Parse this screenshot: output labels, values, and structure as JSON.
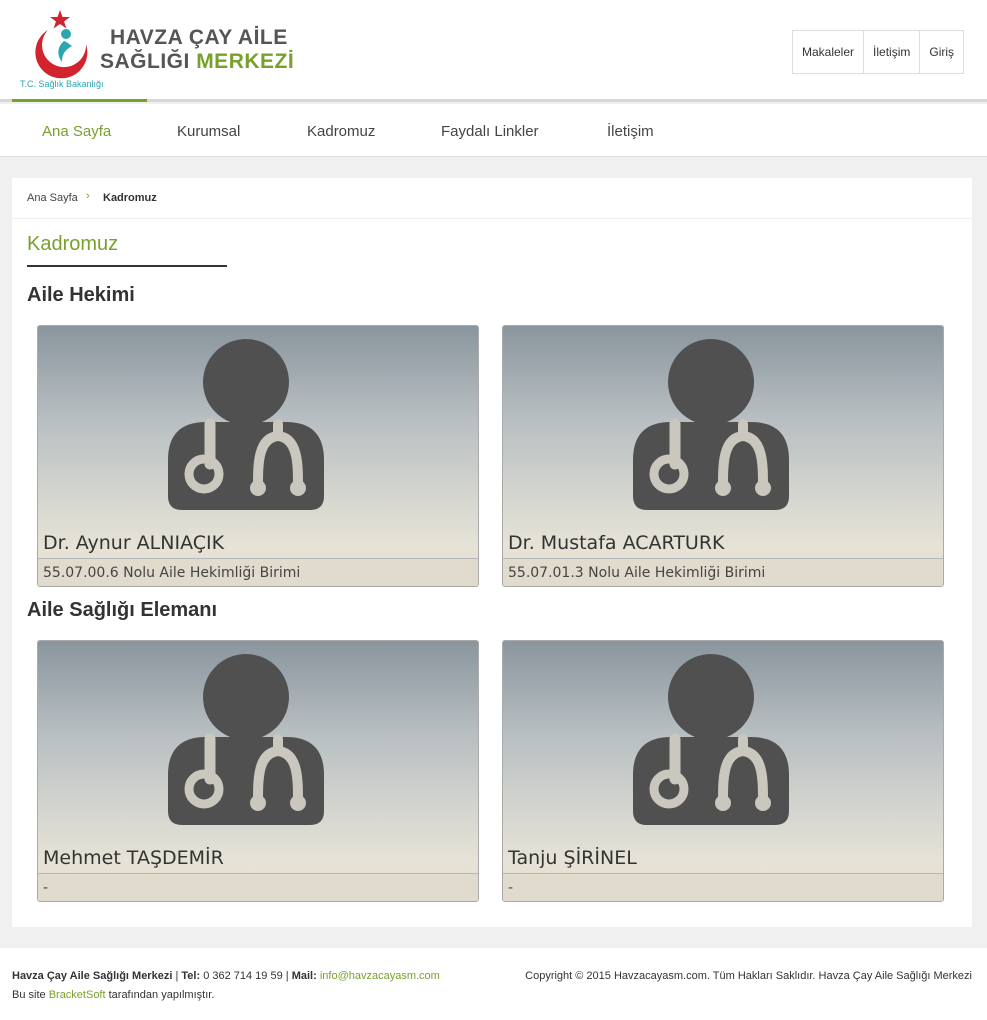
{
  "logo": {
    "line1": "HAVZA ÇAY AİLE",
    "line2_a": "SAĞLIĞI ",
    "line2_b": "MERKEZİ",
    "ministry": "T.C. Sağlık Bakanlığı"
  },
  "top_links": [
    "Makaleler",
    "İletişim",
    "Giriş"
  ],
  "nav": {
    "items": [
      "Ana Sayfa",
      "Kurumsal",
      "Kadromuz",
      "Faydalı Linkler",
      "İletişim"
    ],
    "active": "Ana Sayfa"
  },
  "breadcrumb": {
    "home": "Ana Sayfa",
    "separator": "›",
    "current": "Kadromuz"
  },
  "page_title": "Kadromuz",
  "sections": [
    {
      "title": "Aile Hekimi",
      "cards": [
        {
          "name": "Dr. Aynur ALNIAÇIK",
          "unit": "55.07.00.6 Nolu Aile Hekimliği Birimi"
        },
        {
          "name": "Dr. Mustafa ACARTURK",
          "unit": "55.07.01.3 Nolu Aile Hekimliği Birimi"
        }
      ]
    },
    {
      "title": "Aile Sağlığı Elemanı",
      "cards": [
        {
          "name": "Mehmet TAŞDEMİR",
          "unit": "-"
        },
        {
          "name": "Tanju ŞİRİNEL",
          "unit": "-"
        }
      ]
    }
  ],
  "icons": {
    "card_avatar": "doctor-stethoscope-icon",
    "breadcrumb_sep": "chevron-right-icon"
  },
  "footer": {
    "org": "Havza Çay Aile Sağlığı Merkezi",
    "tel_label": "Tel:",
    "tel": "0 362 714 19 59",
    "mail_label": "Mail:",
    "mail": "info@havzacayasm.com",
    "built_prefix": "Bu site ",
    "built_by": "BracketSoft",
    "built_suffix": " tarafından yapılmıştır.",
    "copyright": "Copyright © 2015 Havzacayasm.com. Tüm Hakları Saklıdır. Havza Çay Aile Sağlığı Merkezi"
  },
  "colors": {
    "accent": "#7aa02c",
    "logo_red": "#d3242e",
    "logo_teal": "#2aa6b0",
    "avatar": "#505050"
  }
}
